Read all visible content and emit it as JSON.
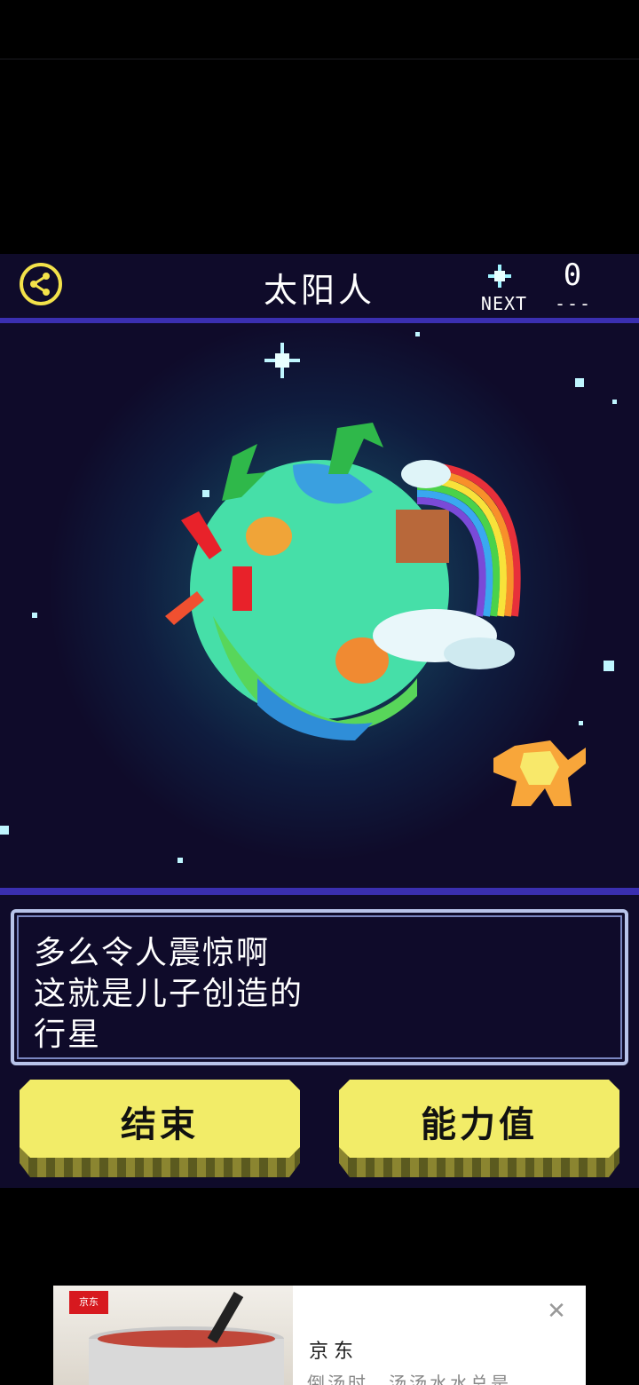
{
  "header": {
    "title": "太阳人",
    "next_label": "NEXT",
    "next_count": "0",
    "next_dashes": "---"
  },
  "dialog": {
    "lines": [
      "多么令人震惊啊",
      "这就是儿子创造的",
      "行星"
    ]
  },
  "buttons": {
    "end_label": "结束",
    "stats_label": "能力值"
  },
  "ad": {
    "logo_text": "京东",
    "brand": "京东",
    "description": "倒汤时，汤汤水水总是…",
    "close_symbol": "✕"
  },
  "colors": {
    "accent_yellow": "#f2ec68",
    "panel_bg": "#0f0b2a",
    "border_blue": "#3a2fb0"
  }
}
